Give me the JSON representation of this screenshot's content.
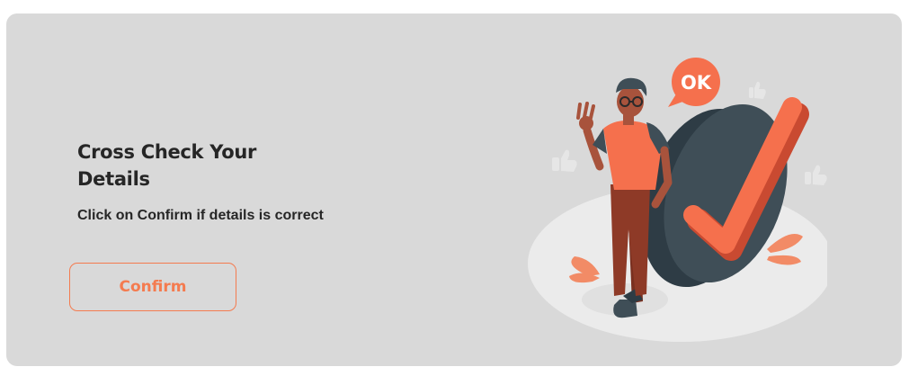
{
  "card": {
    "title": "Cross Check Your Details",
    "subtitle": "Click on Confirm if details is correct",
    "confirm_label": "Confirm"
  },
  "illustration": {
    "bubble_text": "OK",
    "icons": [
      "thumbs-up-icon",
      "checkmark-icon",
      "speech-bubble-icon"
    ]
  },
  "colors": {
    "card_background": "#d9d9d9",
    "accent": "#f47b4f",
    "text": "#262626",
    "badge_dark": "#3f4e57"
  }
}
